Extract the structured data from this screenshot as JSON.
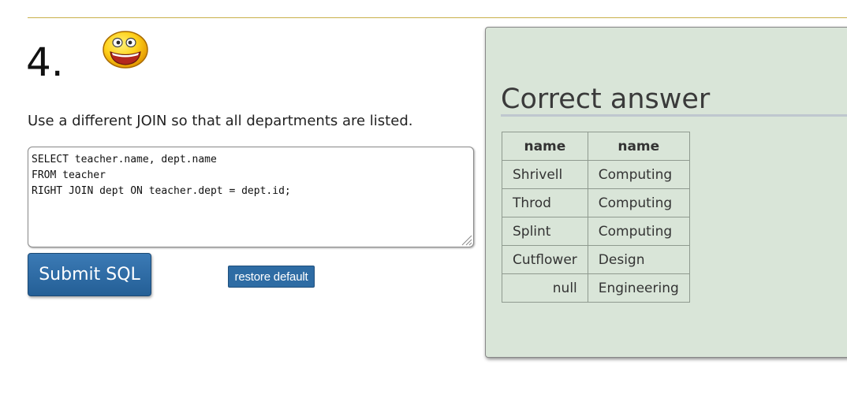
{
  "question": {
    "number": "4.",
    "text": "Use a different JOIN so that all departments are listed."
  },
  "sql_editor": {
    "value": "SELECT teacher.name, dept.name\nFROM teacher\nRIGHT JOIN dept ON teacher.dept = dept.id;"
  },
  "buttons": {
    "submit_label": "Submit SQL",
    "restore_label": "restore default"
  },
  "answer": {
    "title": "Correct answer",
    "headers": [
      "name",
      "name"
    ],
    "rows": [
      [
        "Shrivell",
        "Computing"
      ],
      [
        "Throd",
        "Computing"
      ],
      [
        "Splint",
        "Computing"
      ],
      [
        "Cutflower",
        "Design"
      ],
      [
        "null",
        "Engineering"
      ]
    ]
  },
  "icons": {
    "smiley": "smiley-face-icon",
    "grip": "resize-grip-icon"
  },
  "colors": {
    "accent_button": "#2e6ca4",
    "answer_panel_bg": "#d9e5d8",
    "top_rule": "#c8b04a"
  }
}
